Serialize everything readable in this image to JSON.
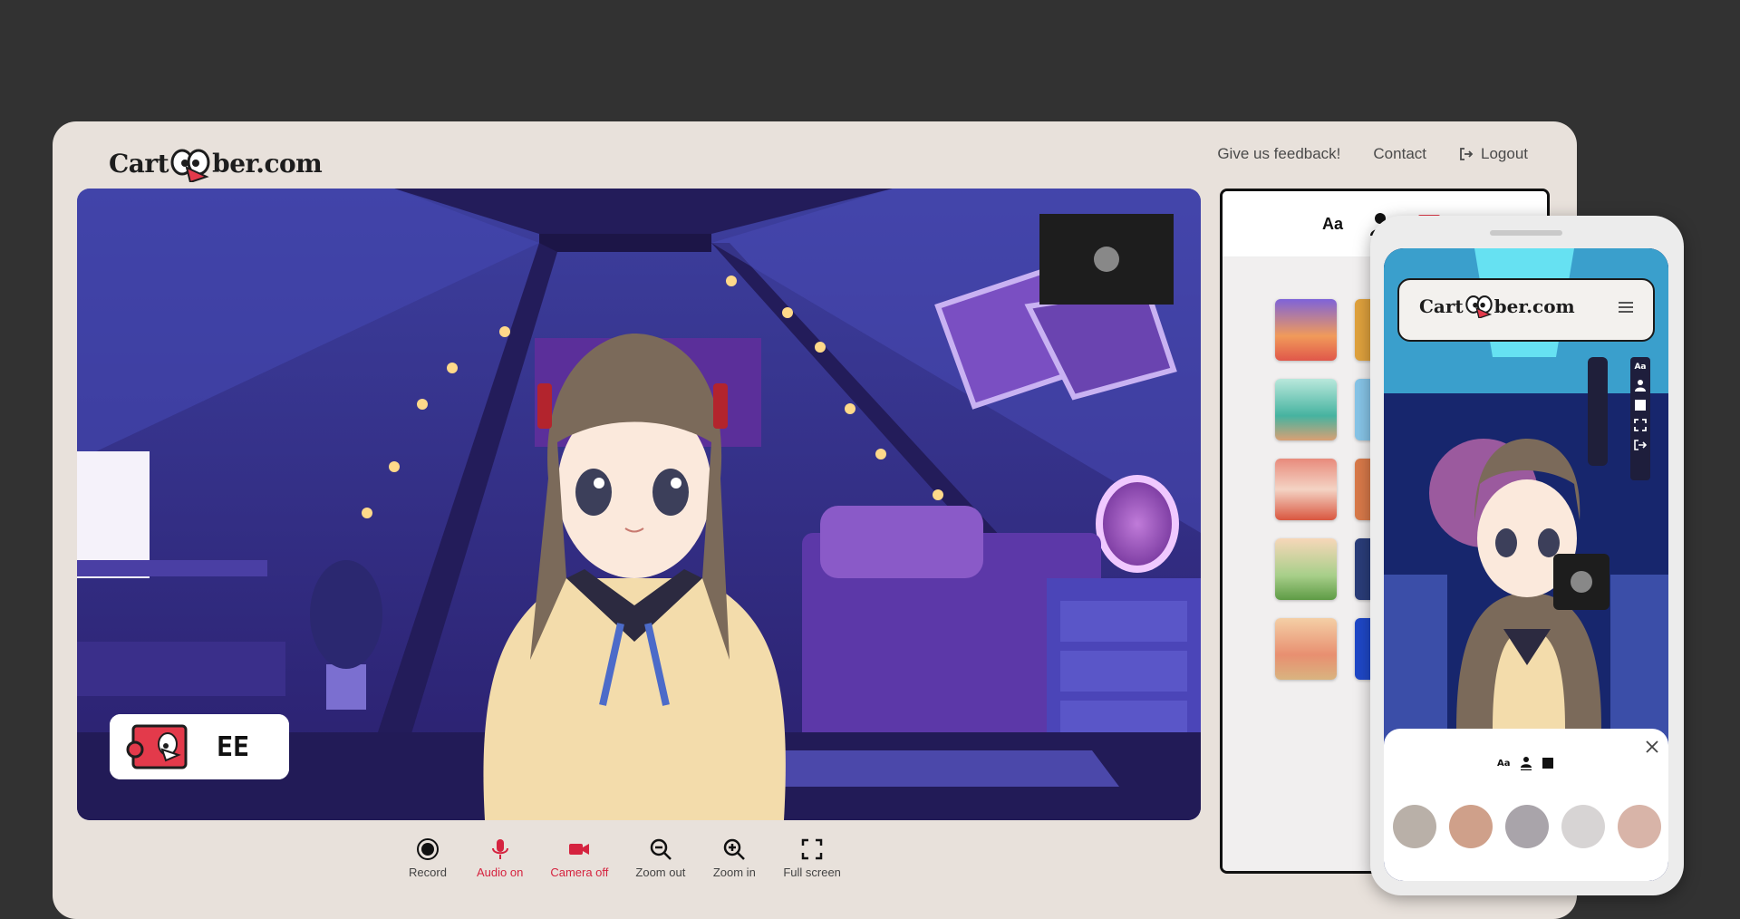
{
  "app": {
    "logo_prefix": "Cart",
    "logo_suffix": "ber.com"
  },
  "nav": {
    "feedback": "Give us feedback!",
    "contact": "Contact",
    "logout": "Logout"
  },
  "stage": {
    "caption_text": "EE"
  },
  "controls": [
    {
      "label": "Record",
      "icon": "record-icon"
    },
    {
      "label": "Audio on",
      "icon": "microphone-icon"
    },
    {
      "label": "Camera off",
      "icon": "camera-icon"
    },
    {
      "label": "Zoom out",
      "icon": "zoom-out-icon"
    },
    {
      "label": "Zoom in",
      "icon": "zoom-in-icon"
    },
    {
      "label": "Full screen",
      "icon": "fullscreen-icon"
    }
  ],
  "panel": {
    "tab_text": "Aa",
    "thumbnails": [
      "sunset",
      "classroom-board",
      "classroom",
      "meadow",
      "kids-room"
    ]
  },
  "phone": {
    "logo_prefix": "Cart",
    "logo_suffix": "ber.com",
    "sheet_tab_text": "Aa"
  },
  "colors": {
    "accent_red": "#d5233f",
    "background": "#323232",
    "window": "#e8e1db"
  }
}
